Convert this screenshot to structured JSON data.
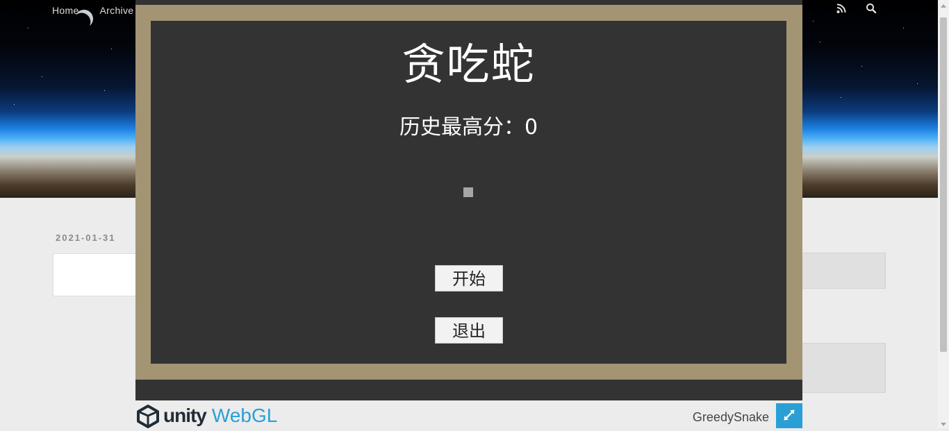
{
  "blog": {
    "nav": {
      "home": "Home",
      "archives": "Archive"
    },
    "icons": [
      "rss-icon",
      "search-icon"
    ],
    "post_date": "2021-01-31"
  },
  "game": {
    "title": "贪吃蛇",
    "high_score_label": "历史最高分：",
    "high_score": "0",
    "start_button": "开始",
    "quit_button": "退出"
  },
  "unity_footer": {
    "logo_text": "unity",
    "platform": "WebGL",
    "game_name": "GreedySnake",
    "fullscreen_icon": "fullscreen-icon"
  },
  "colors": {
    "frame": "#a39474",
    "screen": "#333333",
    "accent": "#2a9fd6"
  }
}
